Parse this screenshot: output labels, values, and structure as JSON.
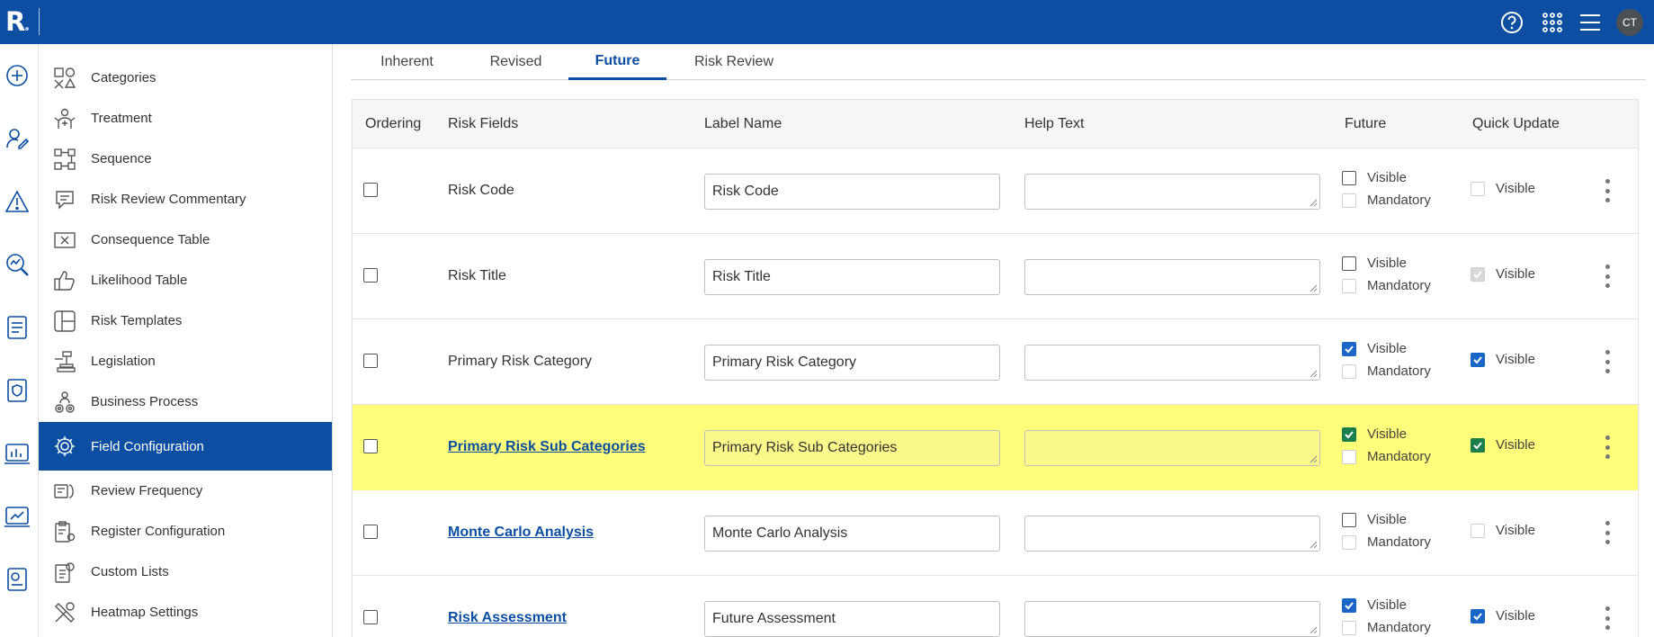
{
  "app": {
    "logo": "R",
    "user_initials": "CT"
  },
  "topbar": {
    "icons": [
      "help-icon",
      "apps-grid-icon",
      "menu-icon"
    ]
  },
  "rail": {
    "icons": [
      "add-icon",
      "user-edit-icon",
      "warning-icon",
      "search-chart-icon",
      "document-icon",
      "shield-document-icon",
      "bar-chart-icon",
      "trend-chart-icon",
      "report-icon"
    ]
  },
  "sidebar": {
    "items": [
      {
        "label": "Categories",
        "icon": "categories-icon"
      },
      {
        "label": "Treatment",
        "icon": "treatment-icon"
      },
      {
        "label": "Sequence",
        "icon": "sequence-icon"
      },
      {
        "label": "Risk Review Commentary",
        "icon": "commentary-icon"
      },
      {
        "label": "Consequence Table",
        "icon": "consequence-icon"
      },
      {
        "label": "Likelihood Table",
        "icon": "thumbs-up-icon"
      },
      {
        "label": "Risk Templates",
        "icon": "template-icon"
      },
      {
        "label": "Legislation",
        "icon": "gavel-icon"
      },
      {
        "label": "Business Process",
        "icon": "process-icon"
      },
      {
        "label": "Field Configuration",
        "icon": "gear-icon",
        "active": true
      },
      {
        "label": "Review Frequency",
        "icon": "frequency-icon"
      },
      {
        "label": "Register Configuration",
        "icon": "register-config-icon"
      },
      {
        "label": "Custom Lists",
        "icon": "list-icon"
      },
      {
        "label": "Heatmap Settings",
        "icon": "tools-icon"
      }
    ]
  },
  "tabs": [
    {
      "label": "Inherent"
    },
    {
      "label": "Revised"
    },
    {
      "label": "Future",
      "active": true
    },
    {
      "label": "Risk Review"
    }
  ],
  "table": {
    "headers": {
      "ordering": "Ordering",
      "risk_fields": "Risk Fields",
      "label_name": "Label Name",
      "help_text": "Help Text",
      "future": "Future",
      "quick_update": "Quick Update"
    },
    "option_labels": {
      "visible": "Visible",
      "mandatory": "Mandatory"
    },
    "rows": [
      {
        "field": "Risk Code",
        "label": "Risk Code",
        "link": false,
        "future_visible": false,
        "quick_visible": "disabled"
      },
      {
        "field": "Risk Title",
        "label": "Risk Title",
        "link": false,
        "future_visible": false,
        "quick_visible": "checked-disabled"
      },
      {
        "field": "Primary Risk Category",
        "label": "Primary Risk Category",
        "link": false,
        "future_visible": true,
        "quick_visible": "checked"
      },
      {
        "field": "Primary Risk Sub Categories",
        "label": "Primary Risk Sub Categories",
        "link": true,
        "highlight": true,
        "future_visible": true,
        "quick_visible": "checked"
      },
      {
        "field": "Monte Carlo Analysis",
        "label": "Monte Carlo Analysis",
        "link": true,
        "future_visible": false,
        "quick_visible": "disabled"
      },
      {
        "field": "Risk Assessment",
        "label": "Future Assessment",
        "link": true,
        "future_visible": true,
        "quick_visible": "checked"
      }
    ]
  }
}
